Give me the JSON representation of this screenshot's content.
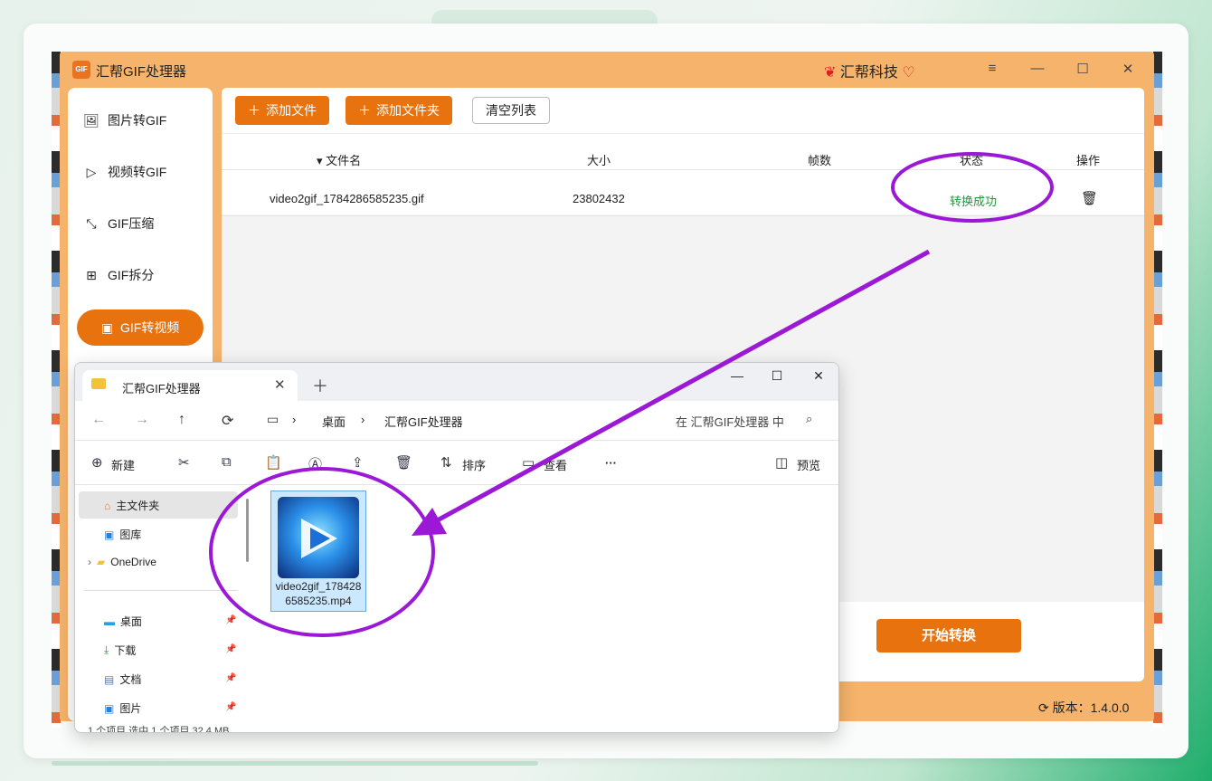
{
  "app": {
    "title": "汇帮GIF处理器",
    "logo_text": "GIF",
    "brand": "汇帮科技",
    "window_controls": [
      "≡",
      "—",
      "☐",
      "✕"
    ]
  },
  "sidebar": {
    "items": [
      {
        "label": "图片转GIF",
        "icon": "image-icon"
      },
      {
        "label": "视频转GIF",
        "icon": "play-circle-icon"
      },
      {
        "label": "GIF压缩",
        "icon": "compress-icon"
      },
      {
        "label": "GIF拆分",
        "icon": "split-icon"
      },
      {
        "label": "GIF转视频",
        "icon": "video-camera-icon",
        "active": true
      }
    ]
  },
  "toolbar": {
    "add_file": "添加文件",
    "add_folder": "添加文件夹",
    "clear_list": "清空列表"
  },
  "table": {
    "headers": [
      "文件名",
      "大小",
      "帧数",
      "状态",
      "操作"
    ],
    "rows": [
      {
        "filename": "video2gif_1784286585235.gif",
        "size": "23802432",
        "frames": "",
        "status": "转换成功"
      }
    ]
  },
  "start_button": "开始转换",
  "version": "版本：1.4.0.0",
  "explorer": {
    "tab_title": "汇帮GIF处理器",
    "breadcrumb": [
      "桌面",
      "汇帮GIF处理器"
    ],
    "search_placeholder": "在 汇帮GIF处理器 中",
    "commands": {
      "new": "新建",
      "sort": "排序",
      "view": "查看",
      "more": "···",
      "preview": "预览"
    },
    "sidebar": {
      "home": "主文件夹",
      "gallery": "图库",
      "onedrive": "OneDrive",
      "desktop": "桌面",
      "downloads": "下载",
      "documents": "文档",
      "pictures": "图片"
    },
    "file": {
      "name": "video2gif_1784286585235.mp4"
    },
    "status_bar": "1 个项目    选中 1 个项目  32.4 MB"
  },
  "colors": {
    "accent": "#e8730e",
    "app_frame": "#f5b36b",
    "success": "#1e9a3a",
    "annotation": "#9b19d6"
  }
}
